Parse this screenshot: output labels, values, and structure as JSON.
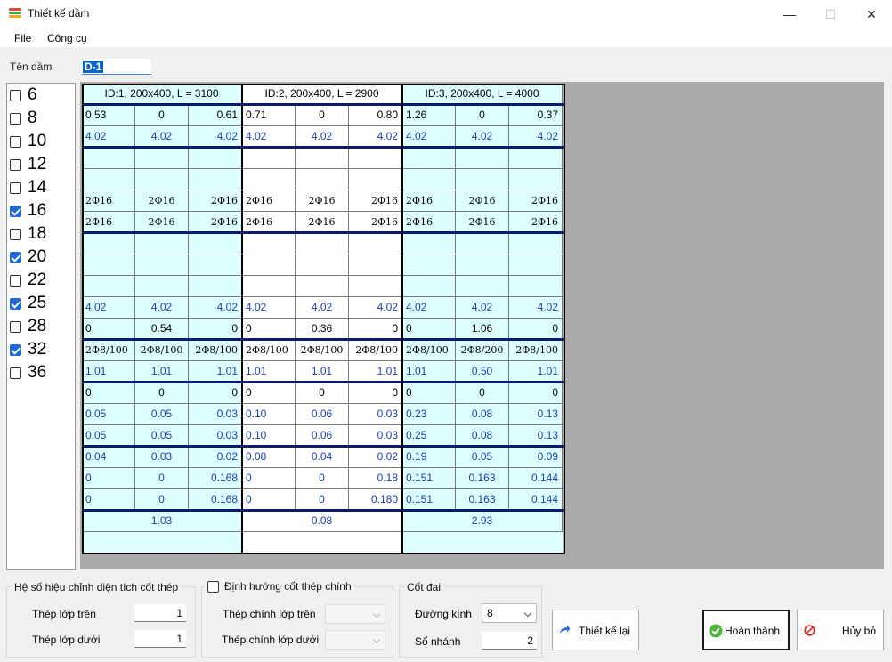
{
  "window": {
    "title": "Thiết kế dầm",
    "min_glyph": "—",
    "max_glyph": "☐",
    "close_glyph": "✕"
  },
  "menu": [
    "File",
    "Công cụ"
  ],
  "name_row": {
    "label": "Tên dầm",
    "value": "D-1"
  },
  "diameters": [
    {
      "value": "6",
      "checked": false
    },
    {
      "value": "8",
      "checked": false
    },
    {
      "value": "10",
      "checked": false
    },
    {
      "value": "12",
      "checked": false
    },
    {
      "value": "14",
      "checked": false
    },
    {
      "value": "16",
      "checked": true
    },
    {
      "value": "18",
      "checked": false
    },
    {
      "value": "20",
      "checked": true
    },
    {
      "value": "22",
      "checked": false
    },
    {
      "value": "25",
      "checked": true
    },
    {
      "value": "28",
      "checked": false
    },
    {
      "value": "32",
      "checked": true
    },
    {
      "value": "36",
      "checked": false
    }
  ],
  "spans": [
    {
      "header": "ID:1, 200x400, L = 3100",
      "rows": [
        [
          "0.53",
          "0",
          "0.61"
        ],
        [
          "4.02",
          "4.02",
          "4.02"
        ],
        [
          "",
          "",
          ""
        ],
        [
          "",
          "",
          ""
        ],
        [
          "2Φ16",
          "2Φ16",
          "2Φ16"
        ],
        [
          "2Φ16",
          "2Φ16",
          "2Φ16"
        ],
        [
          "",
          "",
          ""
        ],
        [
          "",
          "",
          ""
        ],
        [
          "",
          "",
          ""
        ],
        [
          "4.02",
          "4.02",
          "4.02"
        ],
        [
          "0",
          "0.54",
          "0"
        ],
        [
          "2Φ8/100",
          "2Φ8/100",
          "2Φ8/100"
        ],
        [
          "1.01",
          "1.01",
          "1.01"
        ],
        [
          "0",
          "0",
          "0"
        ],
        [
          "0.05",
          "0.05",
          "0.03"
        ],
        [
          "0.05",
          "0.05",
          "0.03"
        ],
        [
          "0.04",
          "0.03",
          "0.02"
        ],
        [
          "0",
          "0",
          "0.168"
        ],
        [
          "0",
          "0",
          "0.168"
        ]
      ],
      "footer": "1.03"
    },
    {
      "header": "ID:2, 200x400, L = 2900",
      "rows": [
        [
          "0.71",
          "0",
          "0.80"
        ],
        [
          "4.02",
          "4.02",
          "4.02"
        ],
        [
          "",
          "",
          ""
        ],
        [
          "",
          "",
          ""
        ],
        [
          "2Φ16",
          "2Φ16",
          "2Φ16"
        ],
        [
          "2Φ16",
          "2Φ16",
          "2Φ16"
        ],
        [
          "",
          "",
          ""
        ],
        [
          "",
          "",
          ""
        ],
        [
          "",
          "",
          ""
        ],
        [
          "4.02",
          "4.02",
          "4.02"
        ],
        [
          "0",
          "0.36",
          "0"
        ],
        [
          "2Φ8/100",
          "2Φ8/100",
          "2Φ8/100"
        ],
        [
          "1.01",
          "1.01",
          "1.01"
        ],
        [
          "0",
          "0",
          "0"
        ],
        [
          "0.10",
          "0.06",
          "0.03"
        ],
        [
          "0.10",
          "0.06",
          "0.03"
        ],
        [
          "0.08",
          "0.04",
          "0.02"
        ],
        [
          "0",
          "0",
          "0.18"
        ],
        [
          "0",
          "0",
          "0.180"
        ]
      ],
      "footer": "0.08"
    },
    {
      "header": "ID:3, 200x400, L = 4000",
      "rows": [
        [
          "1.26",
          "0",
          "0.37"
        ],
        [
          "4.02",
          "4.02",
          "4.02"
        ],
        [
          "",
          "",
          ""
        ],
        [
          "",
          "",
          ""
        ],
        [
          "2Φ16",
          "2Φ16",
          "2Φ16"
        ],
        [
          "2Φ16",
          "2Φ16",
          "2Φ16"
        ],
        [
          "",
          "",
          ""
        ],
        [
          "",
          "",
          ""
        ],
        [
          "",
          "",
          ""
        ],
        [
          "4.02",
          "4.02",
          "4.02"
        ],
        [
          "0",
          "1.06",
          "0"
        ],
        [
          "2Φ8/100",
          "2Φ8/200",
          "2Φ8/100"
        ],
        [
          "1.01",
          "0.50",
          "1.01"
        ],
        [
          "0",
          "0",
          "0"
        ],
        [
          "0.23",
          "0.08",
          "0.13"
        ],
        [
          "0.25",
          "0.08",
          "0.13"
        ],
        [
          "0.19",
          "0.05",
          "0.09"
        ],
        [
          "0.151",
          "0.163",
          "0.144"
        ],
        [
          "0.151",
          "0.163",
          "0.144"
        ]
      ],
      "footer": "2.93"
    }
  ],
  "row_styles": [
    "num",
    "blue",
    "empty",
    "empty",
    "rebar",
    "rebar",
    "empty",
    "empty",
    "empty",
    "blue",
    "num",
    "rebar",
    "blue",
    "num",
    "blue",
    "blue",
    "blue",
    "blue",
    "blue"
  ],
  "span_colors": [
    "#ddffff",
    "#ffffff",
    "#ddffff"
  ],
  "adjust_group": {
    "title": "Hệ số hiệu chỉnh diện tích cốt thép",
    "top_label": "Thép lớp trên",
    "top_value": "1",
    "bottom_label": "Thép lớp dưới",
    "bottom_value": "1"
  },
  "orient_group": {
    "title": "Định hướng cốt thép chính",
    "checked": false,
    "top_label": "Thép chính lớp trên",
    "top_value": "",
    "bottom_label": "Thép chính lớp dưới",
    "bottom_value": ""
  },
  "stirrup_group": {
    "title": "Cốt đai",
    "diameter_label": "Đường kính",
    "diameter_value": "8",
    "legs_label": "Số nhánh",
    "legs_value": "2"
  },
  "buttons": {
    "redesign": "Thiết kế lại",
    "finish": "Hoàn thành",
    "cancel": "Hủy bỏ"
  },
  "colors": {
    "accent": "#1f6ad6",
    "grid_line": "#0a1a6e",
    "value_blue": "#1a3fb5"
  }
}
